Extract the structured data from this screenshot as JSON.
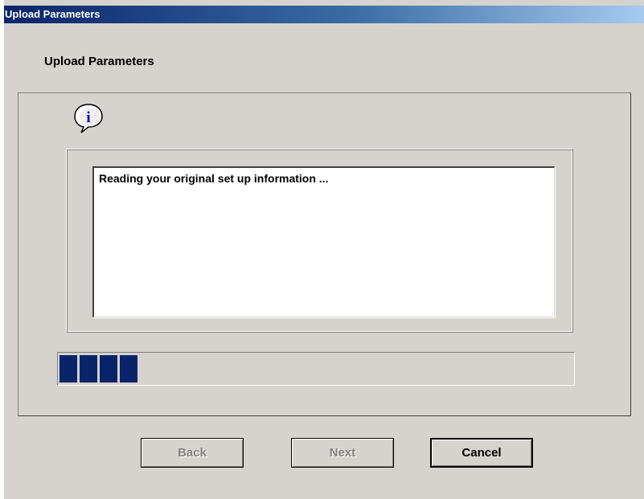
{
  "window": {
    "title": "Upload Parameters"
  },
  "page": {
    "heading": "Upload Parameters"
  },
  "message": {
    "icon": "info-icon",
    "text": "Reading your original set up information ..."
  },
  "progress": {
    "value_percent": 16,
    "blocks": 4,
    "color": "#0a246a"
  },
  "buttons": {
    "back_label": "Back",
    "next_label": "Next",
    "cancel_label": "Cancel"
  },
  "colors": {
    "window_bg": "#d6d3ce",
    "titlebar_start": "#0a246a",
    "titlebar_end": "#a6caf0"
  }
}
